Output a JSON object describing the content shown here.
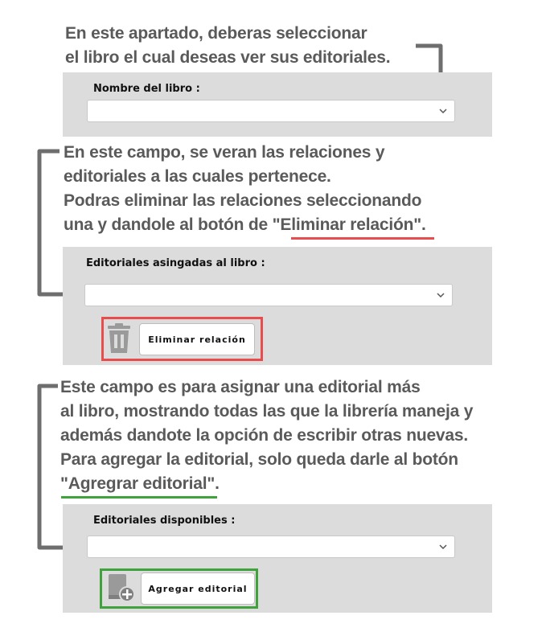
{
  "colors": {
    "text_gray": "#5a5a5a",
    "panel_bg": "#dcdcdc",
    "arrow_gray": "#6e6e6e",
    "highlight_red": "#e84c4c",
    "highlight_green": "#3fa23a"
  },
  "note1": {
    "line1": "En este apartado, deberas seleccionar",
    "line2": "el libro el cual deseas ver sus editoriales."
  },
  "section1": {
    "label": "Nombre del libro :",
    "select_value": "",
    "select_icon": "chevron-down-icon"
  },
  "note2": {
    "line1": "En este campo, se veran las relaciones y",
    "line2": "editoriales a las cuales pertenece.",
    "line3": "Podras eliminar las relaciones seleccionando",
    "line4_prefix": "una y dandole al botón de \"",
    "line4_highlight": "Eliminar relación",
    "line4_suffix": "\"."
  },
  "section2": {
    "label": "Editoriales asingadas al libro :",
    "select_value": "",
    "button_label": "Eliminar relación",
    "button_icon": "trash-icon"
  },
  "note3": {
    "line1": "Este campo es para asignar una editorial más",
    "line2": "al libro, mostrando todas las que la librería maneja y",
    "line3": "además dandote la opción de escribir otras nuevas.",
    "line4": "Para agregar la editorial, solo queda darle al botón",
    "line5_prefix": "\"",
    "line5_highlight": "Agregrar editorial",
    "line5_suffix": "\"."
  },
  "section3": {
    "label": "Editoriales disponibles :",
    "select_value": "",
    "button_label": "Agregar editorial",
    "button_icon": "add-book-icon"
  }
}
